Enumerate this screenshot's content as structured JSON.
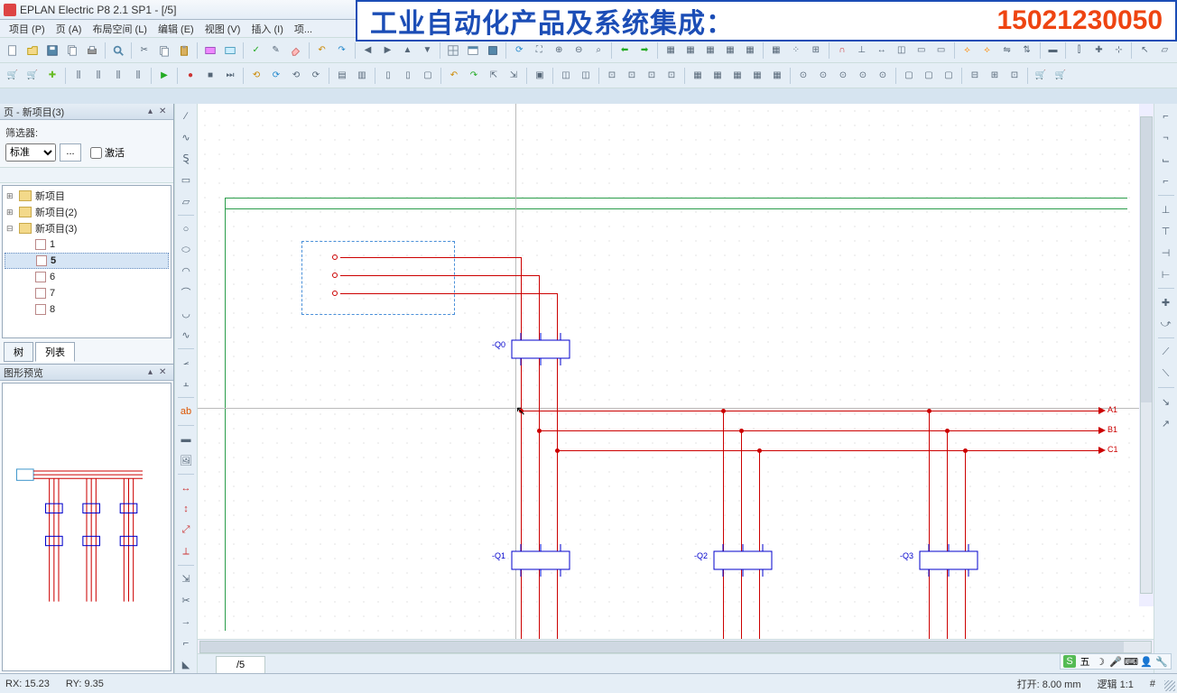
{
  "window": {
    "title": "EPLAN Electric P8 2.1 SP1 - [/5]",
    "min": "—",
    "max": "▭",
    "close": "✕"
  },
  "menu": [
    "项目 (P)",
    "页 (A)",
    "布局空间 (L)",
    "编辑 (E)",
    "视图 (V)",
    "插入 (I)",
    "项..."
  ],
  "banner": {
    "text": "工业自动化产品及系统集成：",
    "phone": "15021230050"
  },
  "page_panel": {
    "title": "页 - 新项目(3)",
    "filter_label": "筛选器:",
    "filter_value": "标准",
    "activate": "激活",
    "tree": [
      {
        "type": "root",
        "label": "新项目"
      },
      {
        "type": "root",
        "label": "新项目(2)"
      },
      {
        "type": "root",
        "label": "新项目(3)",
        "expanded": true
      },
      {
        "type": "page",
        "label": "1"
      },
      {
        "type": "page",
        "label": "5",
        "selected": true
      },
      {
        "type": "page",
        "label": "6"
      },
      {
        "type": "page",
        "label": "7"
      },
      {
        "type": "page",
        "label": "8"
      }
    ],
    "tabs": [
      "树",
      "列表"
    ],
    "active_tab": 0
  },
  "preview_panel": {
    "title": "图形预览"
  },
  "doc_tab": "/5",
  "components": {
    "q0": "-Q0",
    "q1": "-Q1",
    "q2": "-Q2",
    "q3": "-Q3",
    "bus": {
      "a": "A1",
      "b": "B1",
      "c": "C1"
    }
  },
  "status": {
    "rx": "RX: 15.23",
    "ry": "RY: 9.35",
    "open": "打开: 8.00 mm",
    "logic": "逻辑 1:1",
    "hash": "#"
  },
  "ime": {
    "s": "S",
    "wu": "五",
    "moon": "☽",
    "mic": "🎤",
    "kbd": "⌨",
    "user": "👤",
    "wrench": "🔧"
  }
}
